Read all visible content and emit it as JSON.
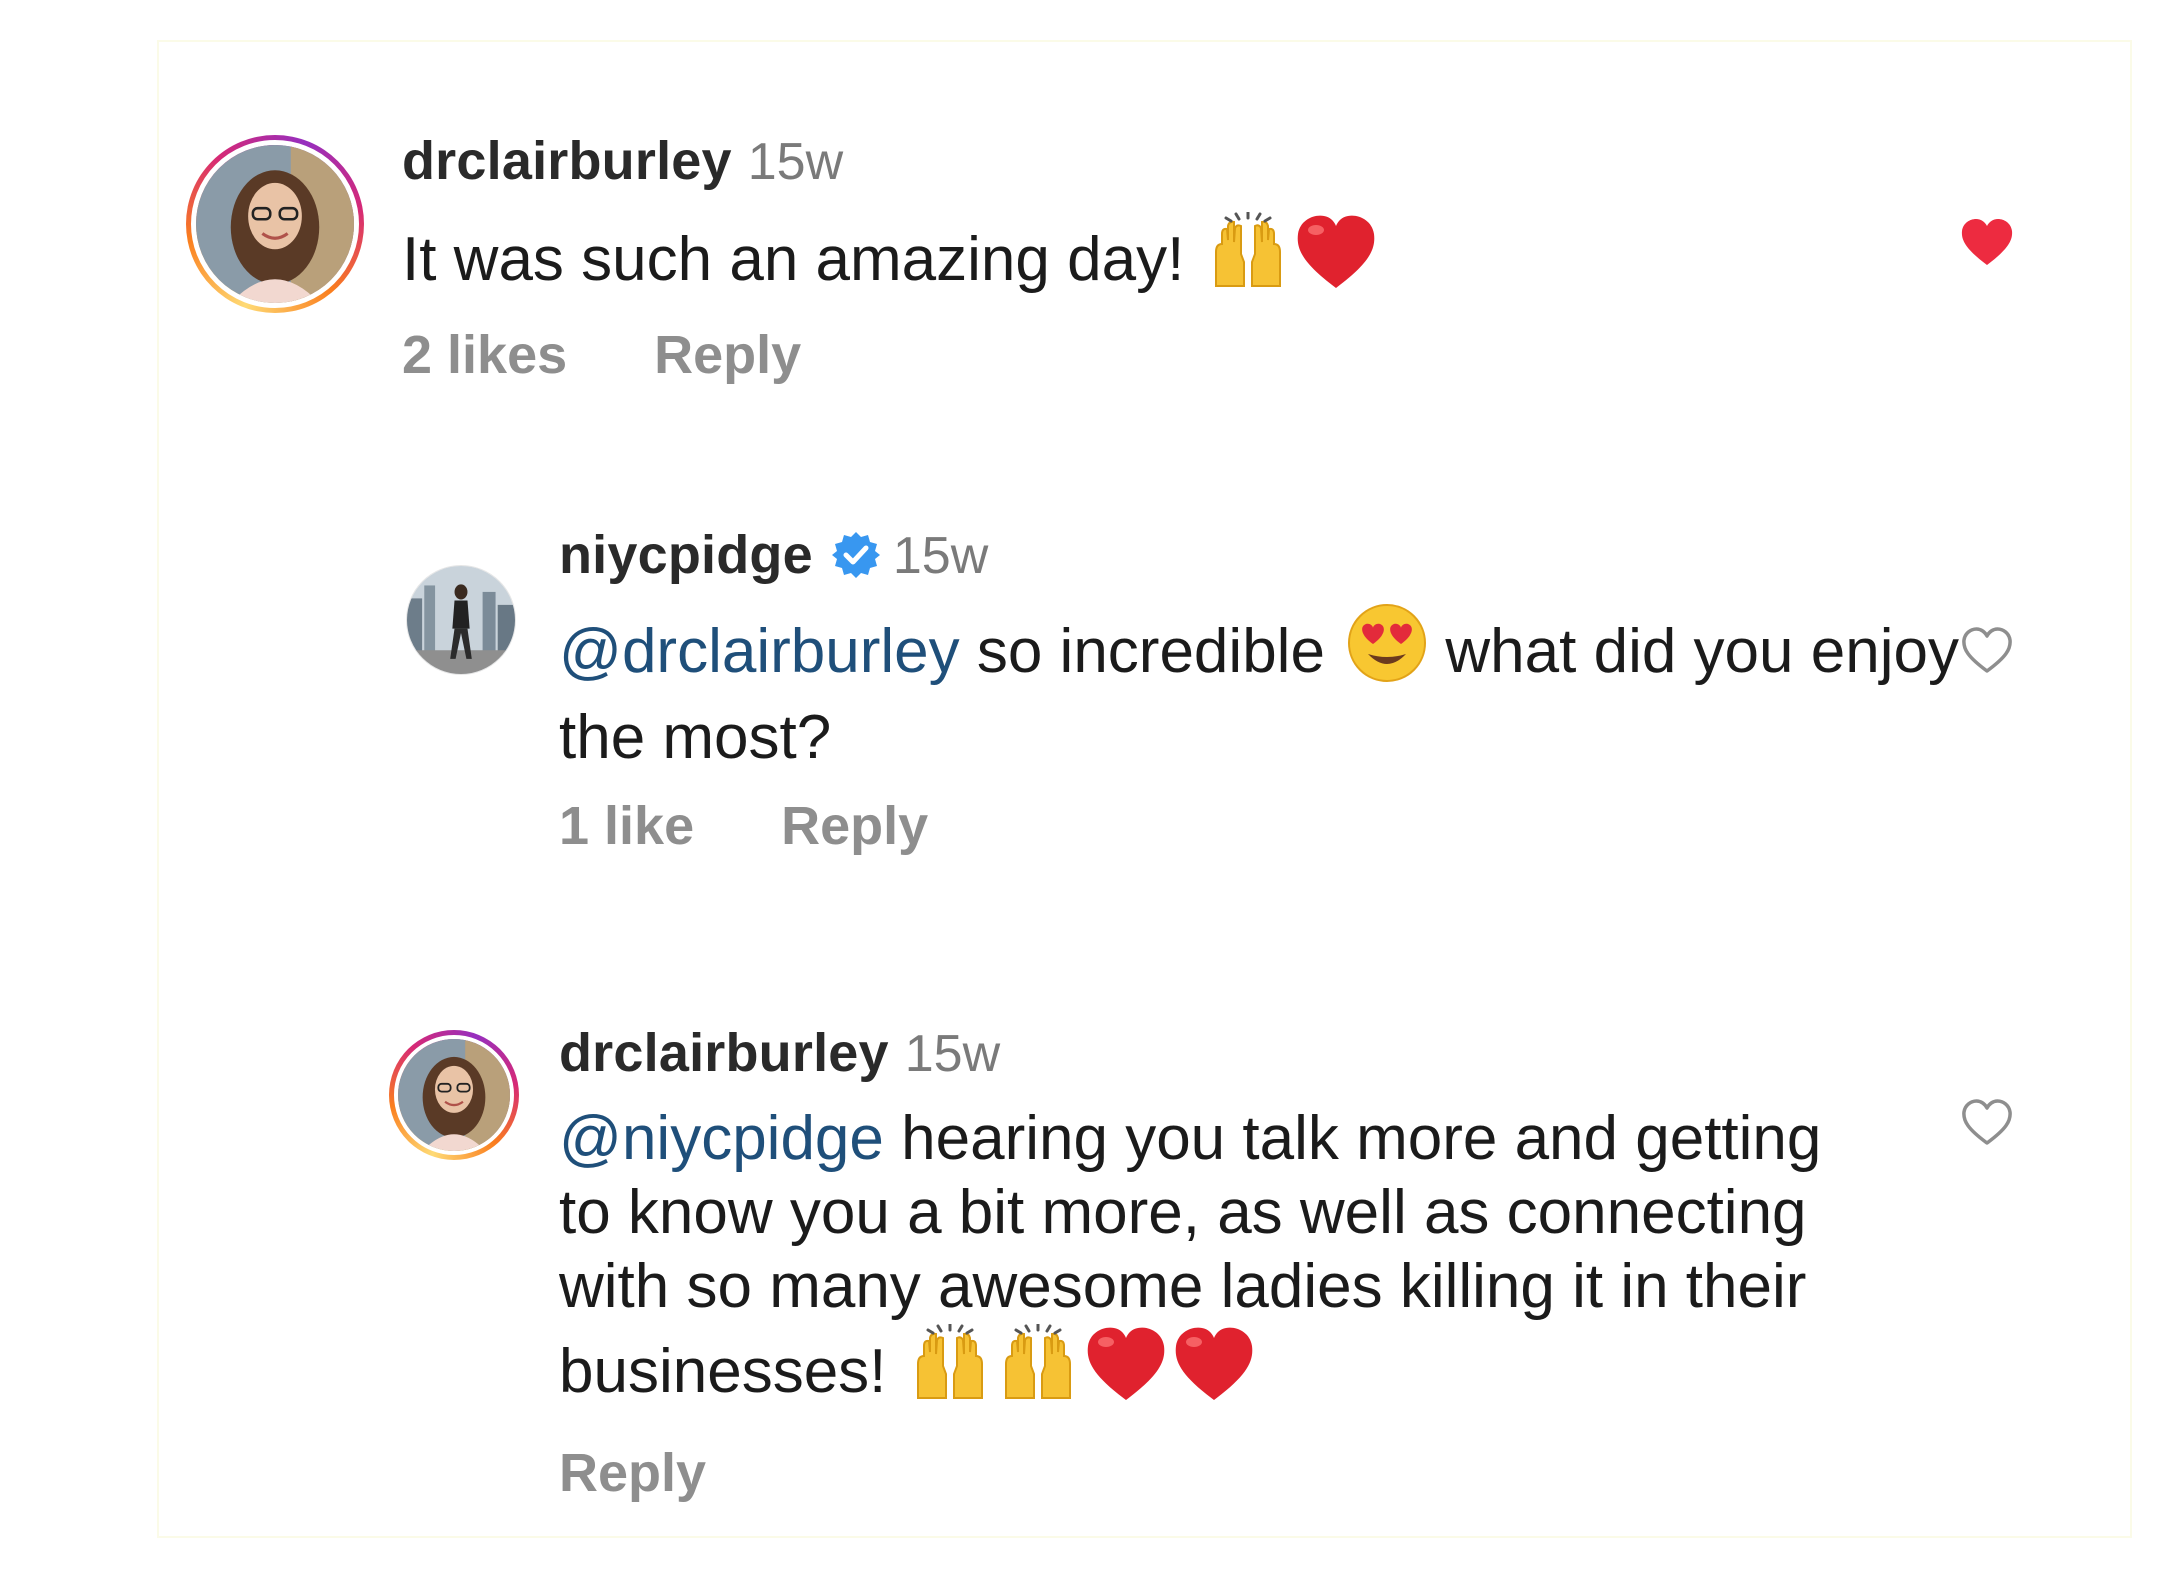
{
  "comments": [
    {
      "username": "drclairburley",
      "time": "15w",
      "text": "It was such an amazing day!",
      "emojis": [
        "raising-hands",
        "red-heart"
      ],
      "likes": "2 likes",
      "reply": "Reply",
      "liked": true,
      "avatar": "story-ring"
    },
    {
      "username": "niycpidge",
      "verified": true,
      "time": "15w",
      "mention": "@drclairburley",
      "text_before_emoji": "so incredible",
      "emoji": "heart-eyes",
      "text_after_emoji": "what did you enjoy the most?",
      "likes": "1 like",
      "reply": "Reply",
      "liked": false
    },
    {
      "username": "drclairburley",
      "time": "15w",
      "mention": "@niycpidge",
      "text": "hearing you talk more and getting to know you a bit more, as well as connecting with so many awesome ladies killing it in their businesses!",
      "emojis": [
        "raising-hands",
        "raising-hands",
        "red-heart",
        "red-heart"
      ],
      "reply": "Reply",
      "liked": false,
      "avatar": "story-ring"
    }
  ],
  "colors": {
    "like_red": "#ed2b40",
    "mention_blue": "#1f4f7a",
    "meta_gray": "#8e8e8e",
    "verified_blue": "#3897f0"
  }
}
